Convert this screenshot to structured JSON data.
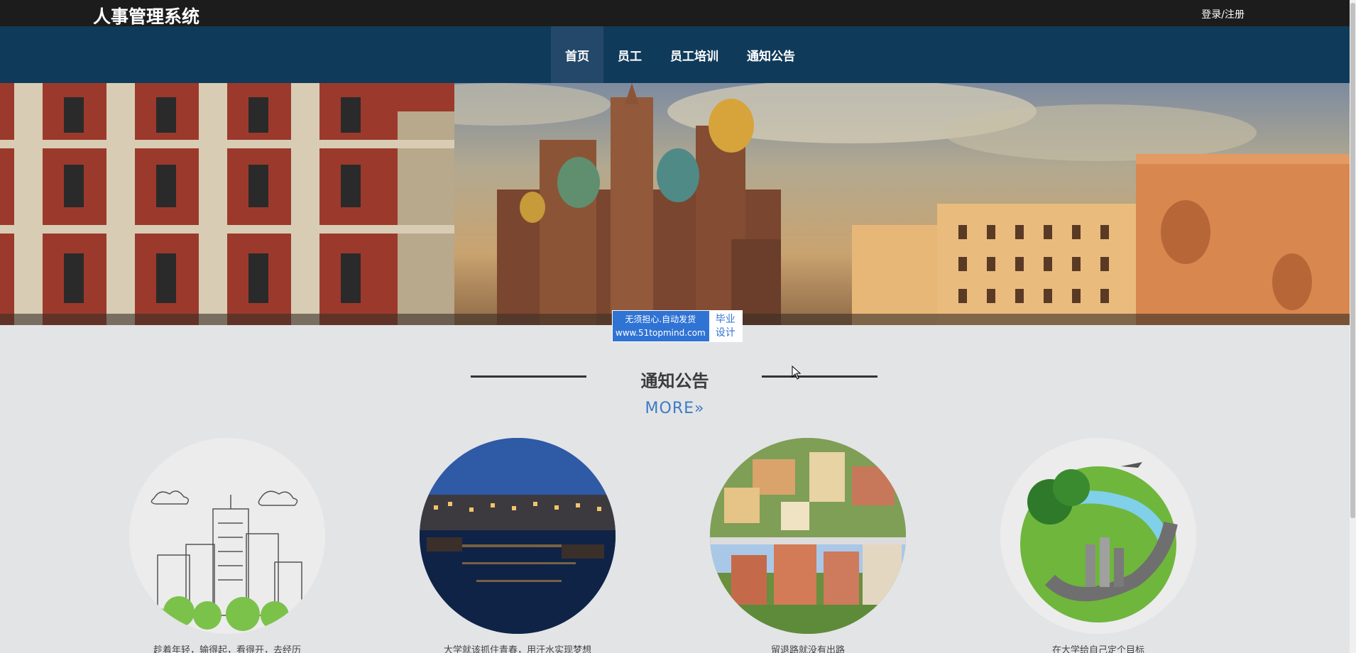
{
  "header": {
    "site_title": "人事管理系统",
    "login_label": "登录/注册"
  },
  "nav": {
    "items": [
      {
        "label": "首页",
        "active": true
      },
      {
        "label": "员工",
        "active": false
      },
      {
        "label": "员工培训",
        "active": false
      },
      {
        "label": "通知公告",
        "active": false
      }
    ]
  },
  "watermark": {
    "line1": "无须担心.自动发货",
    "line2": "www.51topmind.com",
    "side1": "毕业",
    "side2": "设计"
  },
  "notice_section": {
    "title": "通知公告",
    "more_label": "MORE",
    "more_icon": "double-chevron-right-icon"
  },
  "notices": [
    {
      "caption": "趁着年轻，输得起，看得开，去经历"
    },
    {
      "caption": "大学就该抓住青春，用汗水实现梦想"
    },
    {
      "caption": "留退路就没有出路"
    },
    {
      "caption": "在大学给自己定个目标"
    }
  ],
  "colors": {
    "topbar": "#1c1c1c",
    "navbar": "#103a5a",
    "nav_active": "#23486a",
    "accent_link": "#3d7bc4",
    "watermark": "#2f73d4"
  }
}
